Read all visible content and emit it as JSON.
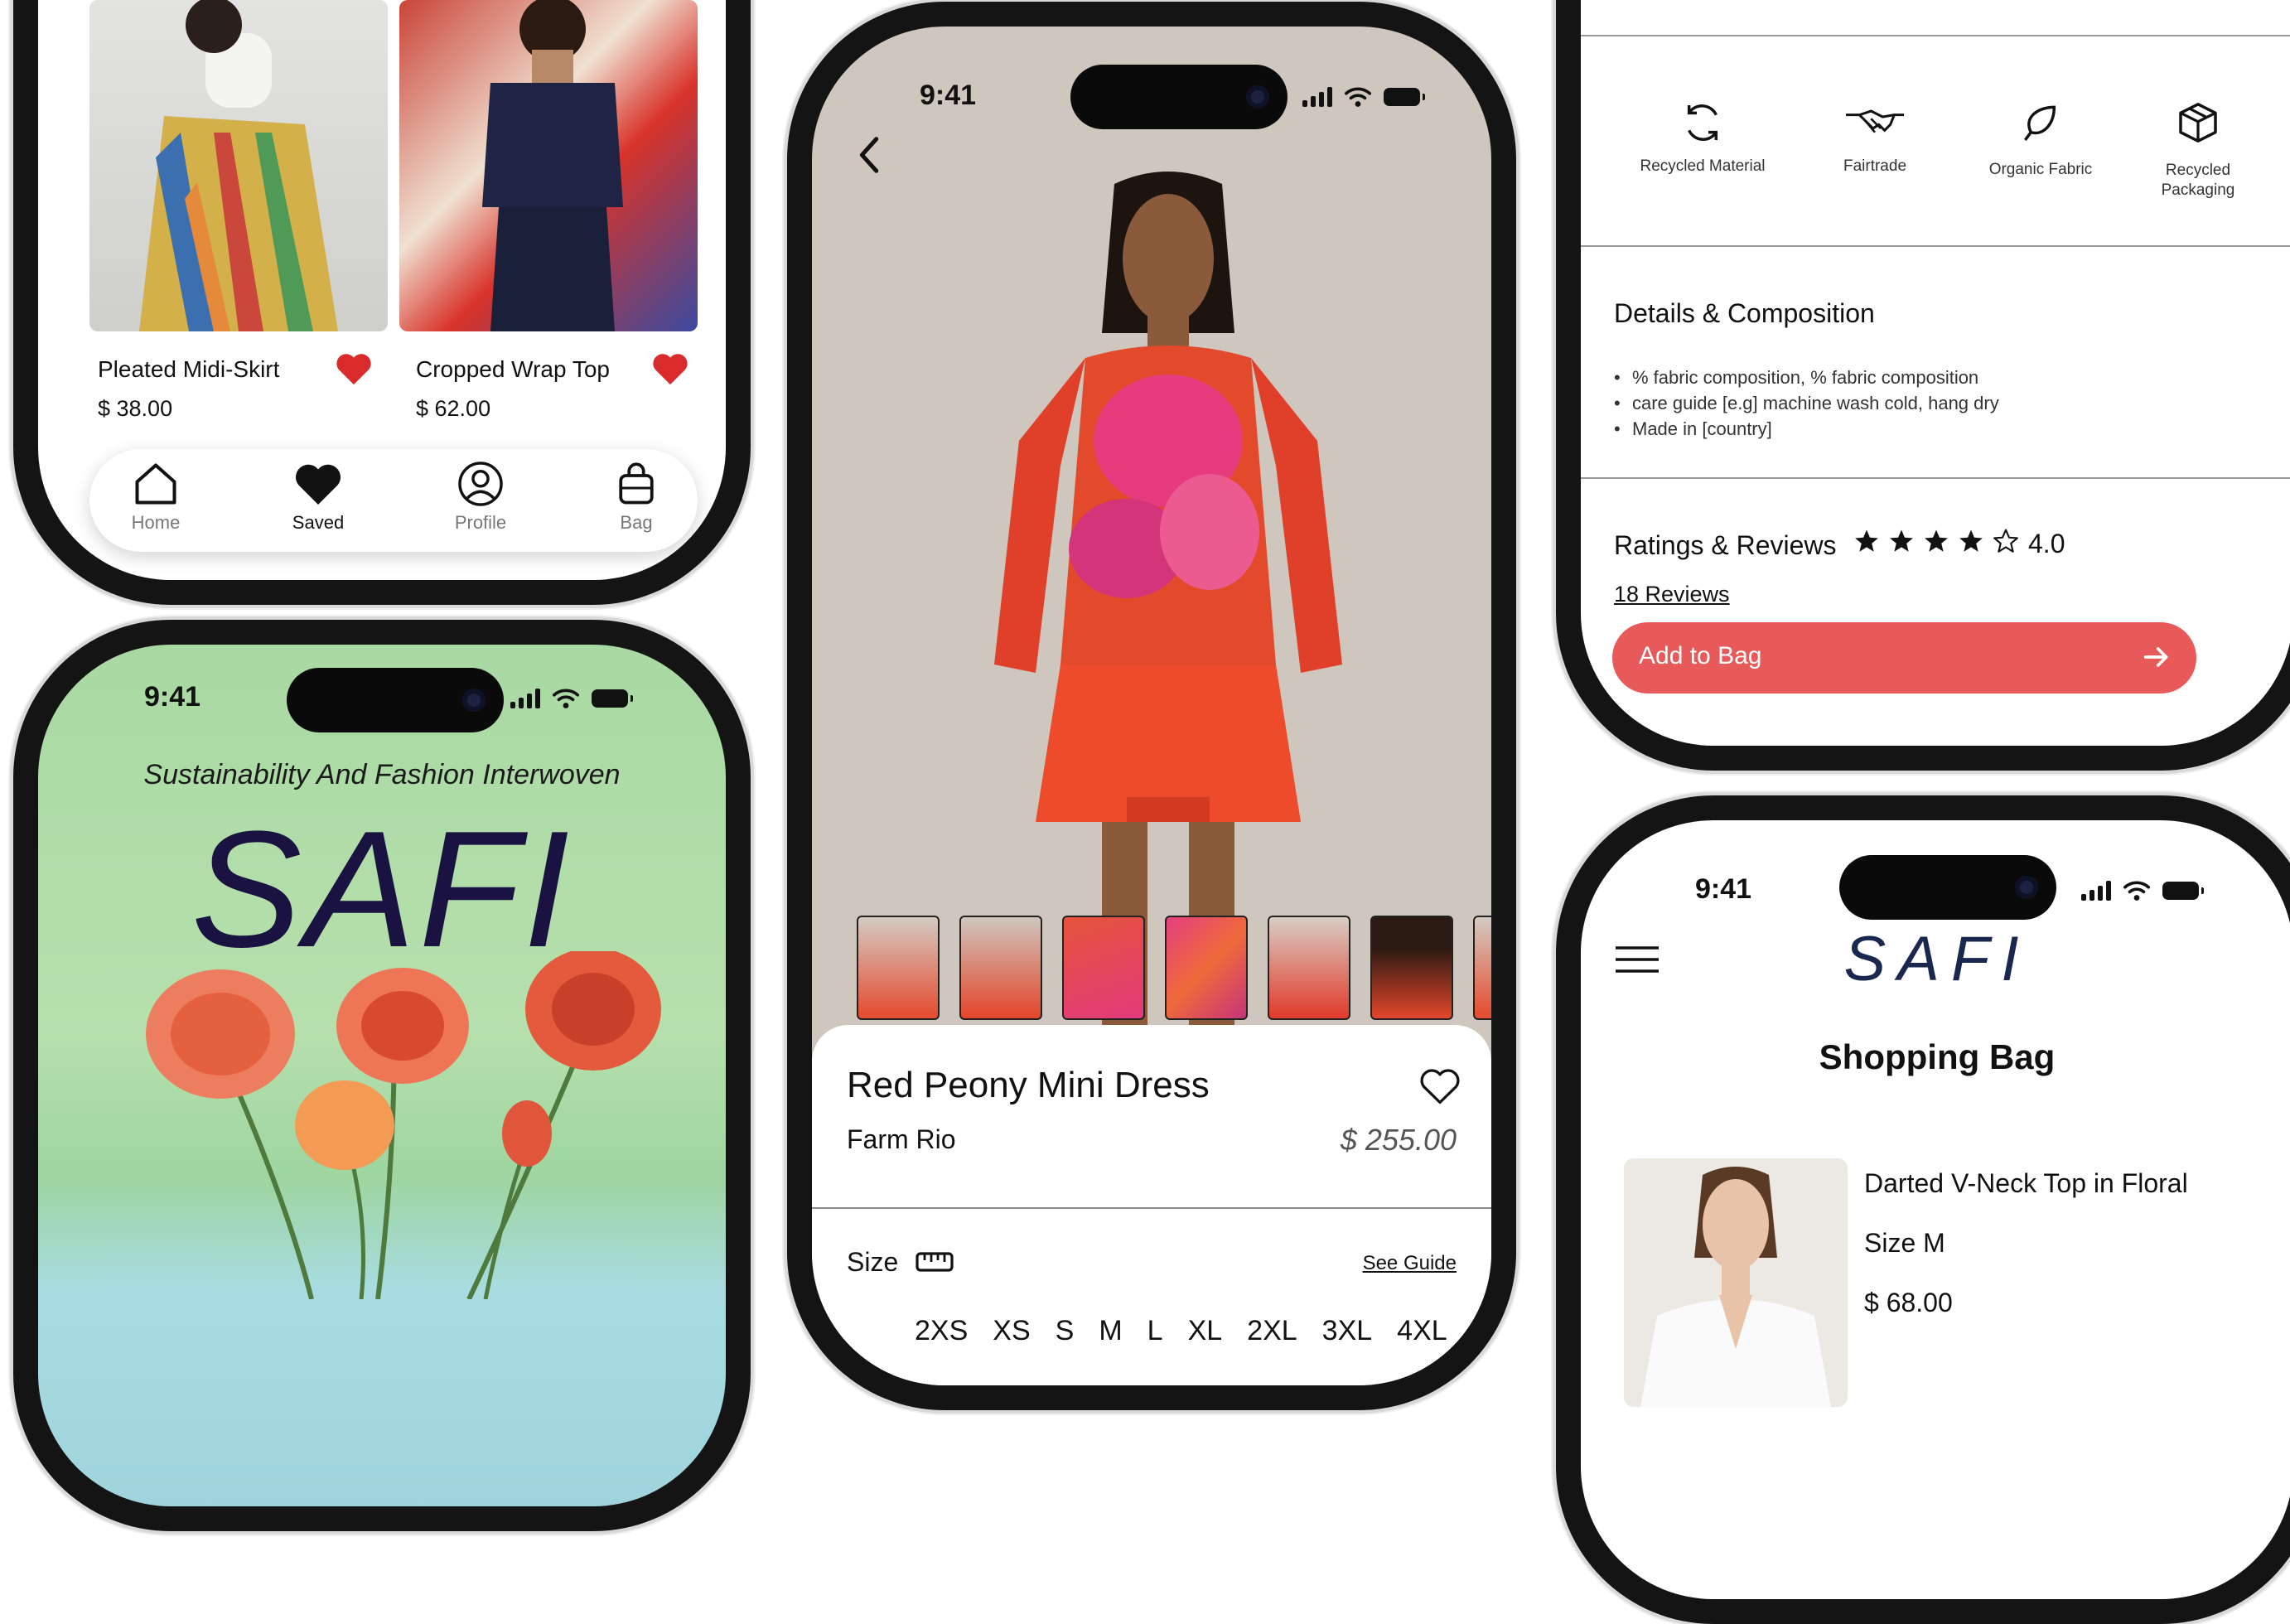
{
  "status": {
    "time": "9:41"
  },
  "saved_screen": {
    "products": [
      {
        "name": "Pleated Midi-Skirt",
        "price": "$ 38.00"
      },
      {
        "name": "Cropped Wrap Top",
        "price": "$ 62.00"
      }
    ],
    "nav": [
      {
        "label": "Home",
        "icon": "home-icon"
      },
      {
        "label": "Saved",
        "icon": "heart-icon"
      },
      {
        "label": "Profile",
        "icon": "profile-icon"
      },
      {
        "label": "Bag",
        "icon": "bag-icon"
      }
    ]
  },
  "splash_screen": {
    "tagline": "Sustainability And Fashion Interwoven",
    "logo": "SAFI"
  },
  "product_screen": {
    "title": "Red Peony Mini Dress",
    "brand": "Farm Rio",
    "price": "$ 255.00",
    "size_label": "Size",
    "see_guide": "See Guide",
    "sizes": [
      "2XS",
      "XS",
      "S",
      "M",
      "L",
      "XL",
      "2XL",
      "3XL",
      "4XL"
    ]
  },
  "details_screen": {
    "badges": [
      {
        "label": "Recycled Material",
        "icon": "recycle-icon"
      },
      {
        "label": "Fairtrade",
        "icon": "handshake-icon"
      },
      {
        "label": "Organic Fabric",
        "icon": "leaf-icon"
      },
      {
        "label": "Recycled Packaging",
        "icon": "box-icon"
      }
    ],
    "details_title": "Details & Composition",
    "details": [
      "% fabric composition, % fabric composition",
      "care guide [e.g] machine wash cold, hang dry",
      "Made in [country]"
    ],
    "ratings_title": "Ratings & Reviews",
    "rating": "4.0",
    "rating_value": 4,
    "reviews_link": "18 Reviews",
    "add_to_bag": "Add to Bag"
  },
  "bag_screen": {
    "logo": "SAFI",
    "title": "Shopping Bag",
    "item": {
      "name": "Darted V-Neck Top in Floral",
      "size": "Size M",
      "price": "$ 68.00"
    }
  },
  "colors": {
    "accent": "#e85a5a",
    "heart": "#d92b2b",
    "splash_green": "#a6d8a0",
    "product_bg": "#cfc6bd"
  }
}
